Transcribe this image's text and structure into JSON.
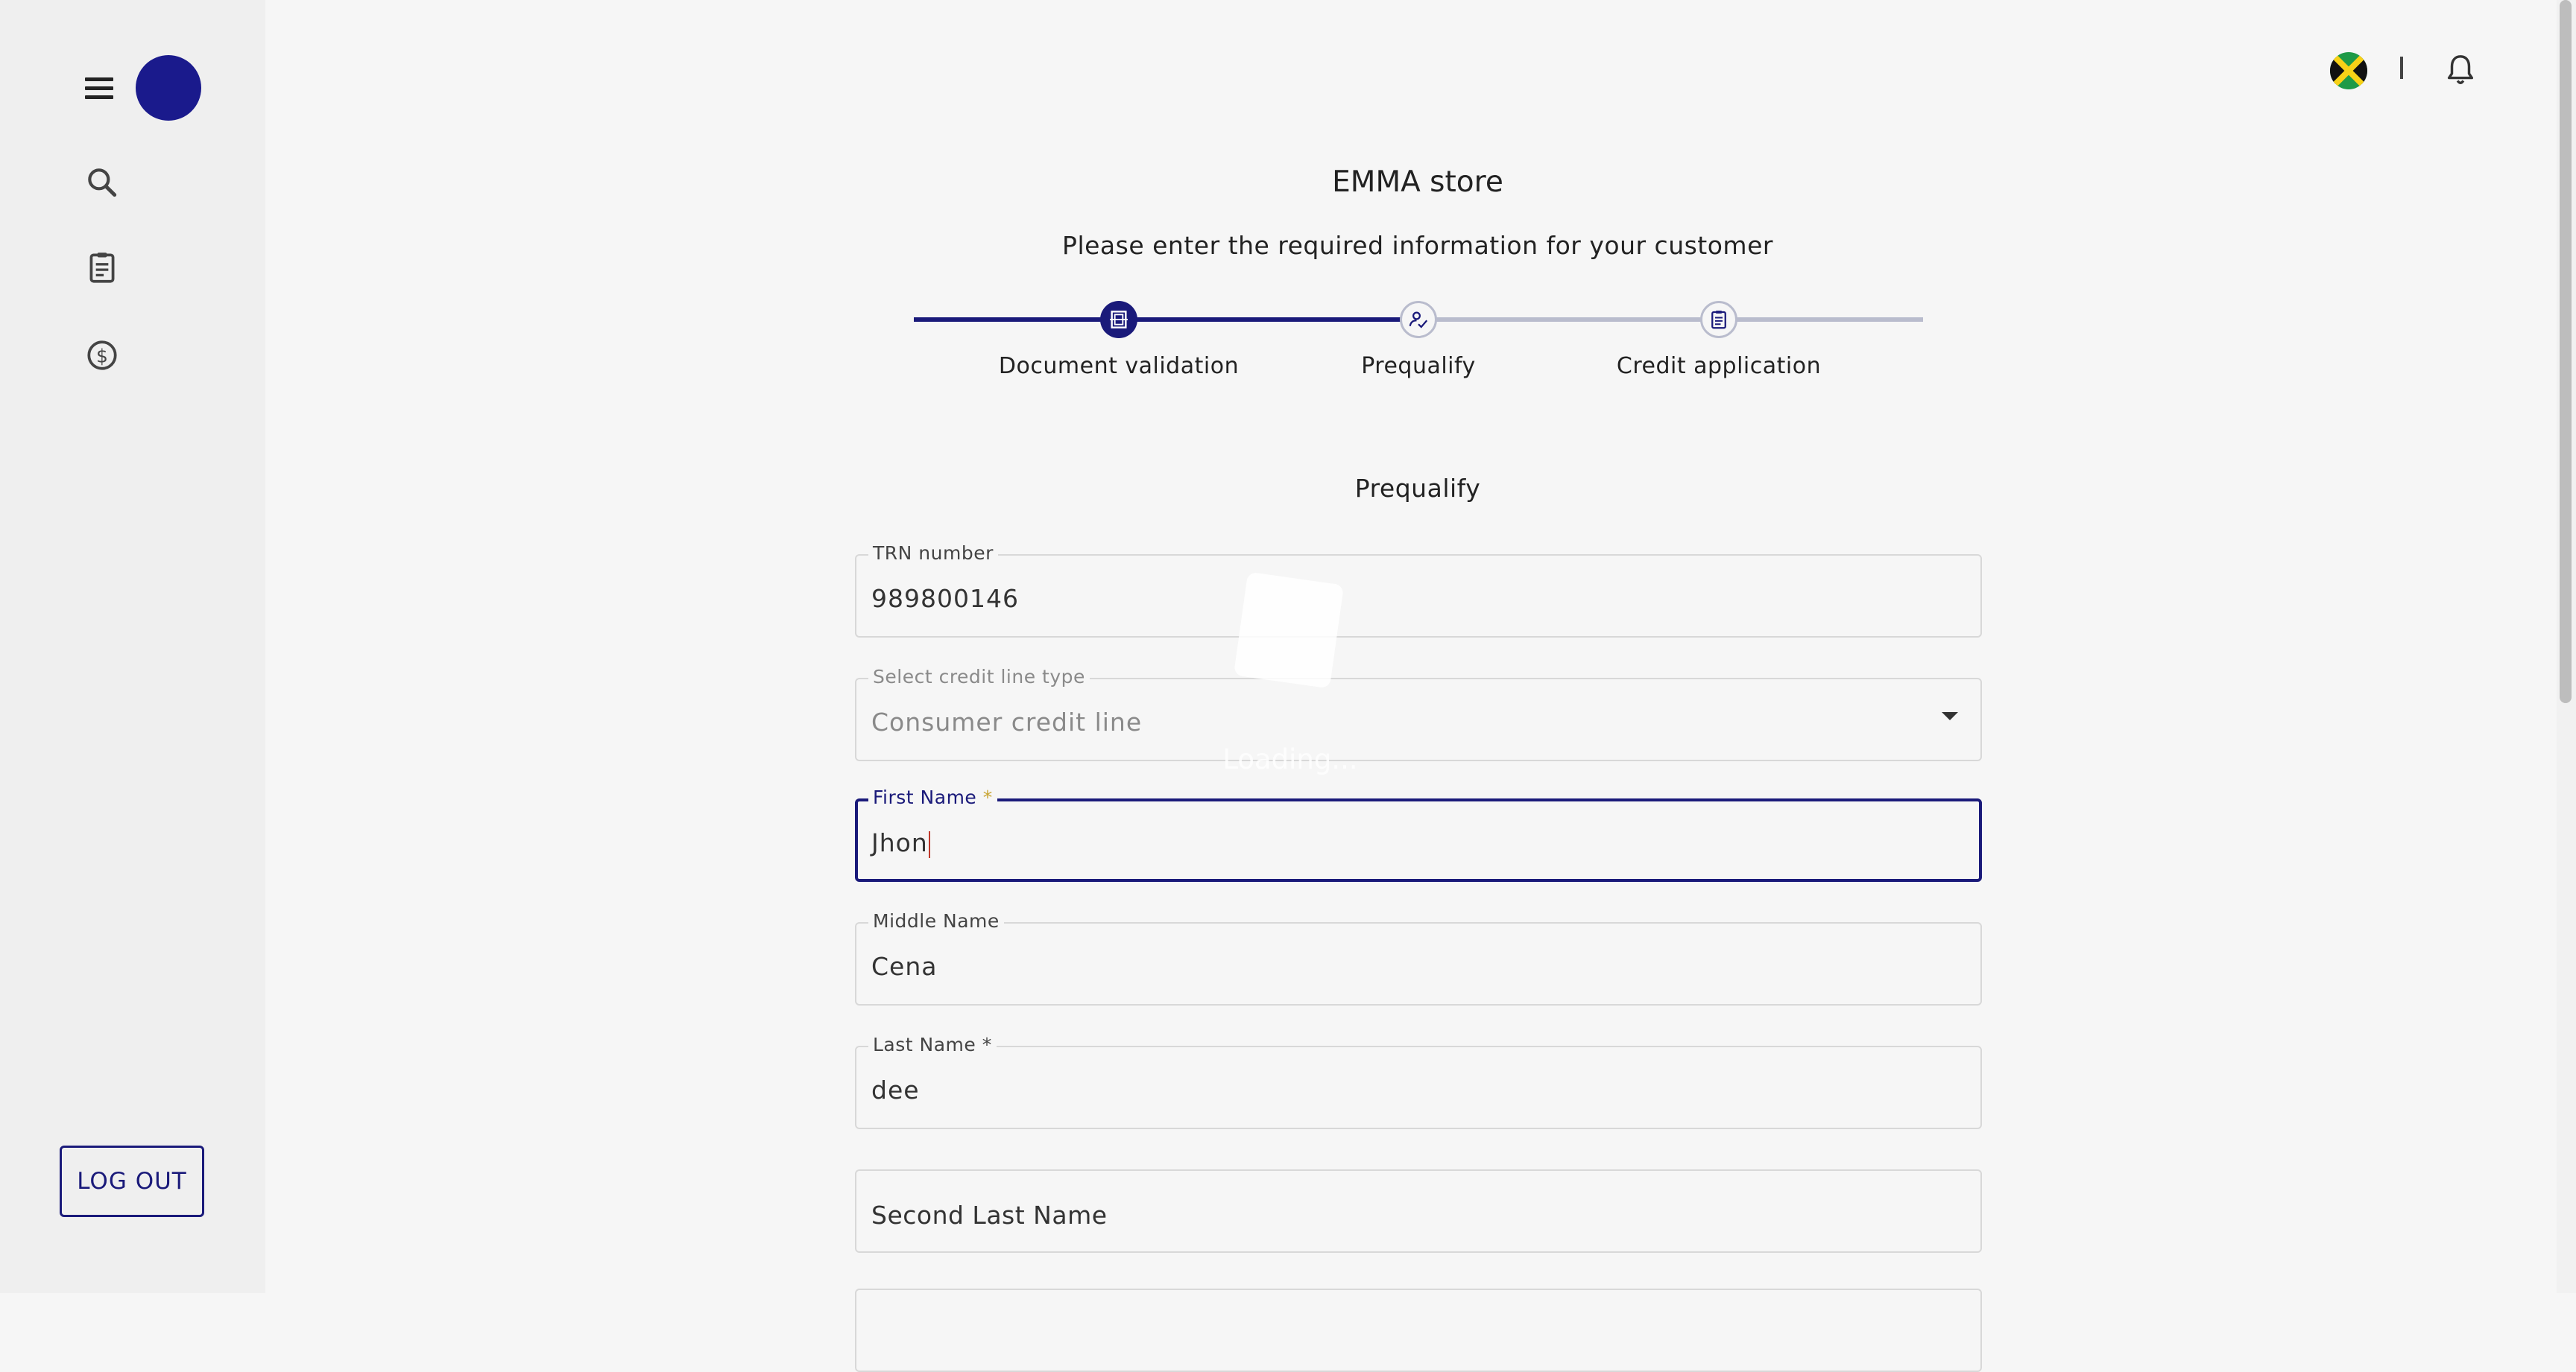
{
  "sidebar": {
    "menu_icon": "hamburger-menu-icon",
    "avatar_color": "#1a1a8c",
    "items": [
      {
        "icon": "search-icon"
      },
      {
        "icon": "clipboard-icon"
      },
      {
        "icon": "dollar-circle-icon"
      }
    ],
    "logout_label": "LOG OUT"
  },
  "topbar": {
    "flag_icon": "jamaica-flag-icon",
    "divider": "|",
    "bell_icon": "bell-icon"
  },
  "header": {
    "store_name": "EMMA store",
    "subtitle": "Please enter the required information for your customer"
  },
  "stepper": {
    "progress": 0.5,
    "steps": [
      {
        "label": "Document validation",
        "status": "done",
        "icon": "document-scan-icon"
      },
      {
        "label": "Prequalify",
        "status": "current",
        "icon": "person-check-icon"
      },
      {
        "label": "Credit application",
        "status": "todo",
        "icon": "clipboard-list-icon"
      }
    ]
  },
  "form": {
    "section_title": "Prequalify",
    "fields": {
      "trn": {
        "label": "TRN number",
        "value": "989800146"
      },
      "credit_line": {
        "label": "Select credit line type",
        "value": "Consumer credit line"
      },
      "first_name": {
        "label": "First Name",
        "required_mark": "*",
        "value": "Jhon"
      },
      "middle_name": {
        "label": "Middle Name",
        "value": "Cena"
      },
      "last_name": {
        "label": "Last Name *",
        "value": "dee"
      },
      "second_last_name": {
        "placeholder": "Second Last Name"
      }
    }
  },
  "loading": {
    "text": "Loading..."
  },
  "colors": {
    "primary": "#1a1a7a",
    "track_inactive": "#b9bccd",
    "background": "#f6f6f6",
    "sidebar": "#efefef"
  }
}
